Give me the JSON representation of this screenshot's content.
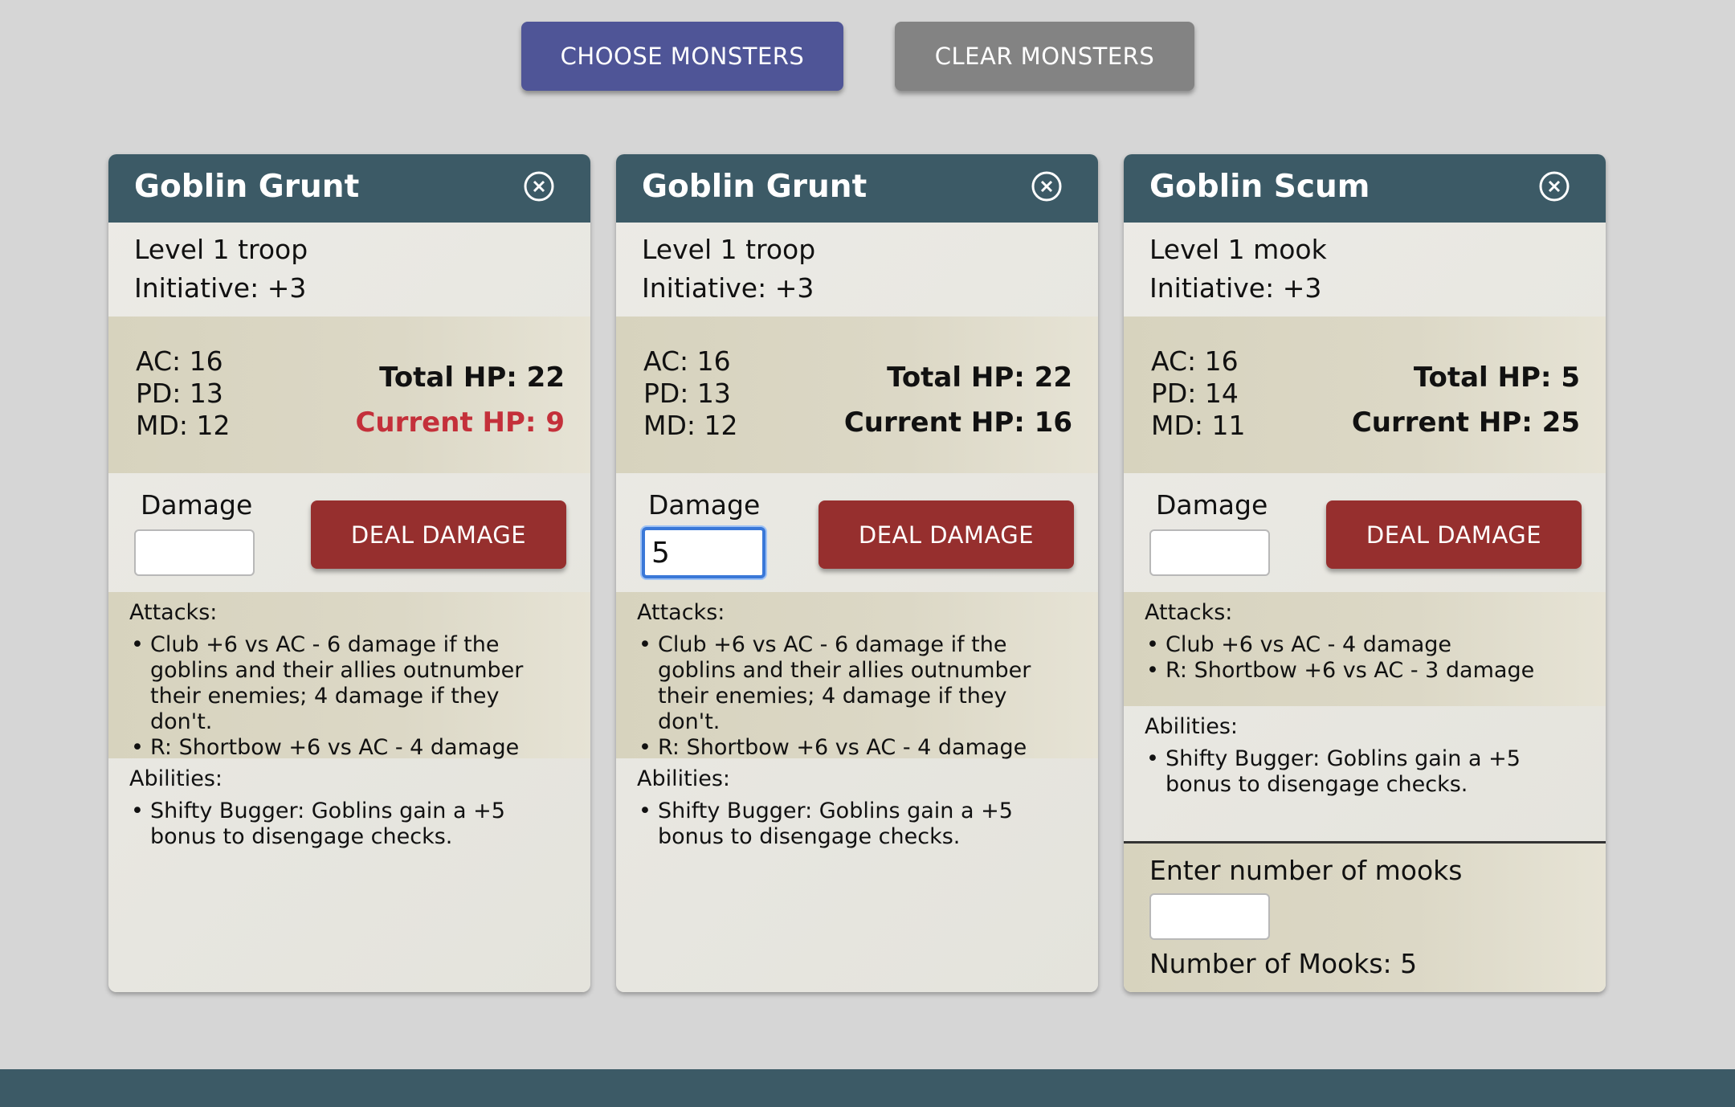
{
  "toolbar": {
    "choose_label": "CHOOSE MONSTERS",
    "clear_label": "CLEAR MONSTERS"
  },
  "labels": {
    "damage": "Damage",
    "deal_damage": "DEAL DAMAGE",
    "attacks": "Attacks:",
    "abilities": "Abilities:",
    "enter_mooks": "Enter number of mooks"
  },
  "cards": [
    {
      "name": "Goblin Grunt",
      "level": "Level 1 troop",
      "initiative": "Initiative: +3",
      "ac": "AC: 16",
      "pd": "PD: 13",
      "md": "MD: 12",
      "total_hp": "Total HP: 22",
      "current_hp": "Current HP: 9",
      "damage_value": "",
      "attacks": [
        "Club +6 vs AC - 6 damage if the goblins and their allies outnumber their enemies; 4 damage if they don't.",
        "R: Shortbow +6 vs AC - 4 damage"
      ],
      "abilities": [
        "Shifty Bugger: Goblins gain a +5 bonus to disengage checks."
      ]
    },
    {
      "name": "Goblin Grunt",
      "level": "Level 1 troop",
      "initiative": "Initiative: +3",
      "ac": "AC: 16",
      "pd": "PD: 13",
      "md": "MD: 12",
      "total_hp": "Total HP: 22",
      "current_hp": "Current HP: 16",
      "damage_value": "5",
      "attacks": [
        "Club +6 vs AC - 6 damage if the goblins and their allies outnumber their enemies; 4 damage if they don't.",
        "R: Shortbow +6 vs AC - 4 damage"
      ],
      "abilities": [
        "Shifty Bugger: Goblins gain a +5 bonus to disengage checks."
      ]
    },
    {
      "name": "Goblin Scum",
      "level": "Level 1 mook",
      "initiative": "Initiative: +3",
      "ac": "AC: 16",
      "pd": "PD: 14",
      "md": "MD: 11",
      "total_hp": "Total HP: 5",
      "current_hp": "Current HP: 25",
      "damage_value": "",
      "attacks": [
        "Club +6 vs AC - 4 damage",
        "R: Shortbow +6 vs AC - 3 damage"
      ],
      "abilities": [
        "Shifty Bugger: Goblins gain a +5 bonus to disengage checks."
      ],
      "mook_count_text": "Number of Mooks: 5"
    }
  ],
  "colors": {
    "header": "#3c5a66",
    "choose_button": "#4f5597",
    "clear_button": "#838383",
    "deal_button": "#962f2e",
    "low_hp": "#c4303a"
  }
}
